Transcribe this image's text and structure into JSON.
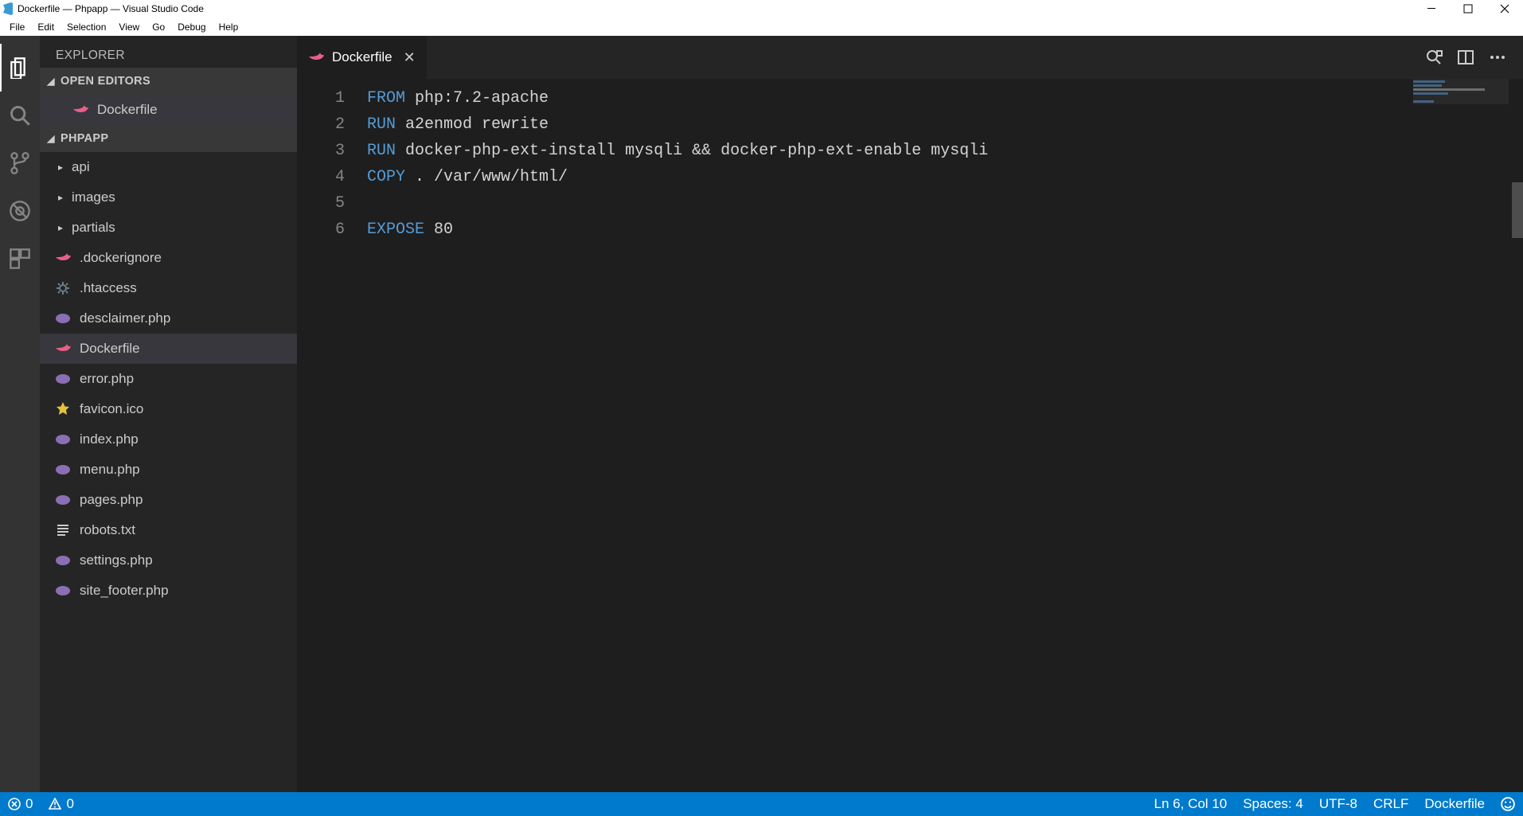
{
  "window": {
    "title": "Dockerfile — Phpapp — Visual Studio Code"
  },
  "menu": {
    "file": "File",
    "edit": "Edit",
    "selection": "Selection",
    "view": "View",
    "go": "Go",
    "debug": "Debug",
    "help": "Help"
  },
  "sidebar": {
    "title": "EXPLORER",
    "open_editors_label": "OPEN EDITORS",
    "workspace_label": "PHPAPP",
    "open_editors": [
      {
        "label": "Dockerfile",
        "icon": "docker"
      }
    ],
    "tree": [
      {
        "type": "folder",
        "label": "api"
      },
      {
        "type": "folder",
        "label": "images"
      },
      {
        "type": "folder",
        "label": "partials"
      },
      {
        "type": "file",
        "label": ".dockerignore",
        "icon": "docker"
      },
      {
        "type": "file",
        "label": ".htaccess",
        "icon": "gear"
      },
      {
        "type": "file",
        "label": "desclaimer.php",
        "icon": "php"
      },
      {
        "type": "file",
        "label": "Dockerfile",
        "icon": "docker",
        "selected": true
      },
      {
        "type": "file",
        "label": "error.php",
        "icon": "php"
      },
      {
        "type": "file",
        "label": "favicon.ico",
        "icon": "star"
      },
      {
        "type": "file",
        "label": "index.php",
        "icon": "php"
      },
      {
        "type": "file",
        "label": "menu.php",
        "icon": "php"
      },
      {
        "type": "file",
        "label": "pages.php",
        "icon": "php"
      },
      {
        "type": "file",
        "label": "robots.txt",
        "icon": "lines"
      },
      {
        "type": "file",
        "label": "settings.php",
        "icon": "php"
      },
      {
        "type": "file",
        "label": "site_footer.php",
        "icon": "php"
      }
    ]
  },
  "tab": {
    "label": "Dockerfile"
  },
  "code_lines": [
    {
      "n": "1",
      "seg": [
        {
          "t": "FROM",
          "c": "kw"
        },
        {
          "t": " php:7.2-apache",
          "c": "plain"
        }
      ]
    },
    {
      "n": "2",
      "seg": [
        {
          "t": "RUN",
          "c": "kw"
        },
        {
          "t": " a2enmod rewrite",
          "c": "plain"
        }
      ]
    },
    {
      "n": "3",
      "seg": [
        {
          "t": "RUN",
          "c": "kw"
        },
        {
          "t": " docker-php-ext-install mysqli && docker-php-ext-enable mysqli",
          "c": "plain"
        }
      ]
    },
    {
      "n": "4",
      "seg": [
        {
          "t": "COPY",
          "c": "kw"
        },
        {
          "t": " . /var/www/html/",
          "c": "plain"
        }
      ]
    },
    {
      "n": "5",
      "seg": []
    },
    {
      "n": "6",
      "seg": [
        {
          "t": "EXPOSE",
          "c": "kw"
        },
        {
          "t": " 80",
          "c": "plain"
        }
      ]
    }
  ],
  "status": {
    "errors": "0",
    "warnings": "0",
    "ln_col": "Ln 6, Col 10",
    "spaces": "Spaces: 4",
    "encoding": "UTF-8",
    "eol": "CRLF",
    "language": "Dockerfile"
  }
}
